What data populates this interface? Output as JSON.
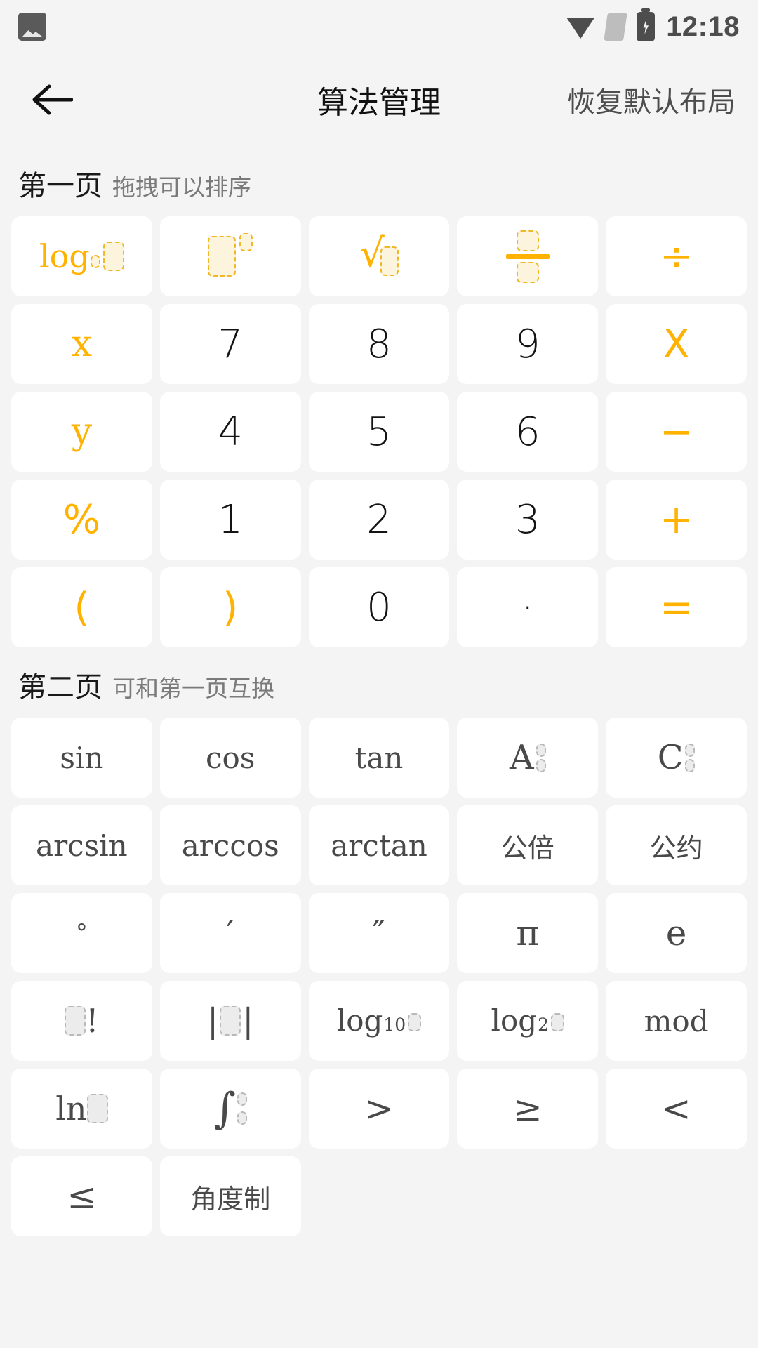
{
  "statusbar": {
    "time": "12:18",
    "icons": [
      "image-icon",
      "wifi-icon",
      "sim-card-icon",
      "battery-charging-icon"
    ]
  },
  "appbar": {
    "back_icon": "back-arrow-icon",
    "title": "算法管理",
    "action_label": "恢复默认布局"
  },
  "colors": {
    "accent": "#ffb300",
    "key_bg": "#ffffff",
    "page_bg": "#f4f4f4",
    "text_dark": "#141414",
    "text_gray": "#494949",
    "placeholder_border_accent": "#f0b726",
    "placeholder_border_gray": "#b9b9b9"
  },
  "sections": [
    {
      "title": "第一页",
      "subtitle": "拖拽可以排序",
      "keys": [
        {
          "name": "log-base-key",
          "label": "log□",
          "style": "accent",
          "render": "log-base"
        },
        {
          "name": "power-key",
          "label": "□^□",
          "style": "accent",
          "render": "power"
        },
        {
          "name": "sqrt-key",
          "label": "√□",
          "style": "accent",
          "render": "sqrt"
        },
        {
          "name": "fraction-key",
          "label": "□/□",
          "style": "accent",
          "render": "fraction"
        },
        {
          "name": "divide-key",
          "label": "÷",
          "style": "accent",
          "render": "glyph-op"
        },
        {
          "name": "variable-x-key",
          "label": "x",
          "style": "accent",
          "render": "var"
        },
        {
          "name": "digit-7-key",
          "label": "7",
          "style": "dark",
          "render": "num"
        },
        {
          "name": "digit-8-key",
          "label": "8",
          "style": "dark",
          "render": "num"
        },
        {
          "name": "digit-9-key",
          "label": "9",
          "style": "dark",
          "render": "num"
        },
        {
          "name": "multiply-key",
          "label": "X",
          "style": "accent",
          "render": "glyph-op"
        },
        {
          "name": "variable-y-key",
          "label": "y",
          "style": "accent",
          "render": "var"
        },
        {
          "name": "digit-4-key",
          "label": "4",
          "style": "dark",
          "render": "num"
        },
        {
          "name": "digit-5-key",
          "label": "5",
          "style": "dark",
          "render": "num"
        },
        {
          "name": "digit-6-key",
          "label": "6",
          "style": "dark",
          "render": "num"
        },
        {
          "name": "minus-key",
          "label": "−",
          "style": "accent",
          "render": "glyph-op"
        },
        {
          "name": "percent-key",
          "label": "%",
          "style": "accent",
          "render": "glyph-op"
        },
        {
          "name": "digit-1-key",
          "label": "1",
          "style": "dark",
          "render": "num"
        },
        {
          "name": "digit-2-key",
          "label": "2",
          "style": "dark",
          "render": "num"
        },
        {
          "name": "digit-3-key",
          "label": "3",
          "style": "dark",
          "render": "num"
        },
        {
          "name": "plus-key",
          "label": "+",
          "style": "accent",
          "render": "glyph-op"
        },
        {
          "name": "left-paren-key",
          "label": "(",
          "style": "accent",
          "render": "glyph-op"
        },
        {
          "name": "right-paren-key",
          "label": ")",
          "style": "accent",
          "render": "glyph-op"
        },
        {
          "name": "digit-0-key",
          "label": "0",
          "style": "dark",
          "render": "num"
        },
        {
          "name": "decimal-point-key",
          "label": "·",
          "style": "dark",
          "render": "num"
        },
        {
          "name": "equals-key",
          "label": "=",
          "style": "accent",
          "render": "glyph-op"
        }
      ]
    },
    {
      "title": "第二页",
      "subtitle": "可和第一页互换",
      "keys": [
        {
          "name": "sin-key",
          "label": "sin",
          "style": "gray",
          "render": "fn"
        },
        {
          "name": "cos-key",
          "label": "cos",
          "style": "gray",
          "render": "fn"
        },
        {
          "name": "tan-key",
          "label": "tan",
          "style": "gray",
          "render": "fn"
        },
        {
          "name": "permutation-key",
          "label": "A□□",
          "style": "gray",
          "render": "ac",
          "letter": "A"
        },
        {
          "name": "combination-key",
          "label": "C□□",
          "style": "gray",
          "render": "ac",
          "letter": "C"
        },
        {
          "name": "arcsin-key",
          "label": "arcsin",
          "style": "gray",
          "render": "fn"
        },
        {
          "name": "arccos-key",
          "label": "arccos",
          "style": "gray",
          "render": "fn"
        },
        {
          "name": "arctan-key",
          "label": "arctan",
          "style": "gray",
          "render": "fn"
        },
        {
          "name": "lcm-key",
          "label": "公倍",
          "style": "gray",
          "render": "cn"
        },
        {
          "name": "gcd-key",
          "label": "公约",
          "style": "gray",
          "render": "cn"
        },
        {
          "name": "degree-key",
          "label": "°",
          "style": "gray",
          "render": "degsym"
        },
        {
          "name": "arcminute-key",
          "label": "′",
          "style": "gray",
          "render": "sym"
        },
        {
          "name": "arcsecond-key",
          "label": "″",
          "style": "gray",
          "render": "sym"
        },
        {
          "name": "pi-key",
          "label": "π",
          "style": "gray",
          "render": "sym"
        },
        {
          "name": "euler-e-key",
          "label": "e",
          "style": "gray",
          "render": "sym"
        },
        {
          "name": "factorial-key",
          "label": "□!",
          "style": "gray",
          "render": "factorial"
        },
        {
          "name": "absolute-key",
          "label": "|□|",
          "style": "gray",
          "render": "abs"
        },
        {
          "name": "log10-key",
          "label": "log10□",
          "style": "gray",
          "render": "logn",
          "base": "10"
        },
        {
          "name": "log2-key",
          "label": "log2□",
          "style": "gray",
          "render": "logn",
          "base": "2"
        },
        {
          "name": "mod-key",
          "label": "mod",
          "style": "gray",
          "render": "fn"
        },
        {
          "name": "ln-key",
          "label": "ln□",
          "style": "gray",
          "render": "ln"
        },
        {
          "name": "integral-key",
          "label": "∫□□",
          "style": "gray",
          "render": "integral"
        },
        {
          "name": "greater-key",
          "label": ">",
          "style": "gray",
          "render": "sym"
        },
        {
          "name": "greater-equal-key",
          "label": "≥",
          "style": "gray",
          "render": "sym"
        },
        {
          "name": "less-key",
          "label": "<",
          "style": "gray",
          "render": "sym"
        },
        {
          "name": "less-equal-key",
          "label": "≤",
          "style": "gray",
          "render": "sym"
        },
        {
          "name": "degree-mode-key",
          "label": "角度制",
          "style": "gray",
          "render": "cn"
        }
      ]
    }
  ]
}
